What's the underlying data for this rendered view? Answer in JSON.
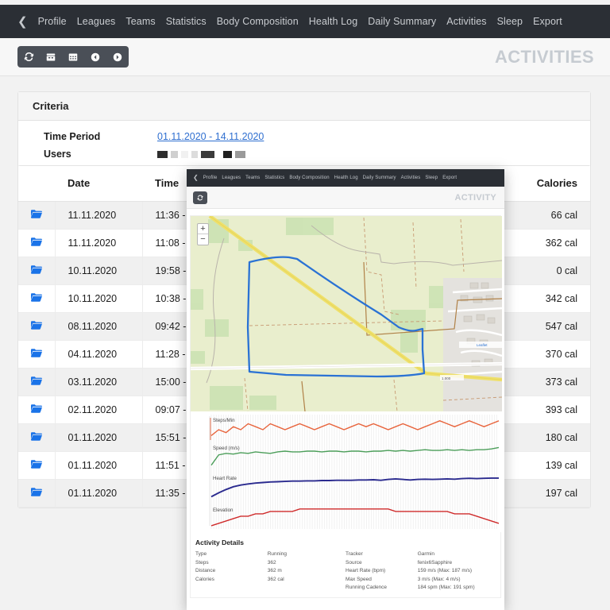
{
  "nav": {
    "back_icon": "chevron-left-icon",
    "items": [
      "Profile",
      "Leagues",
      "Teams",
      "Statistics",
      "Body Composition",
      "Health Log",
      "Daily Summary",
      "Activities",
      "Sleep",
      "Export"
    ]
  },
  "toolbar": {
    "buttons": [
      {
        "name": "refresh-button",
        "icon": "refresh-icon"
      },
      {
        "name": "date-picker-button",
        "icon": "calendar-icon"
      },
      {
        "name": "month-picker-button",
        "icon": "calendar-grid-icon"
      },
      {
        "name": "previous-button",
        "icon": "chevron-left-circle-icon"
      },
      {
        "name": "next-button",
        "icon": "chevron-right-circle-icon"
      }
    ],
    "page_title": "ACTIVITIES"
  },
  "criteria": {
    "heading": "Criteria",
    "time_period_label": "Time Period",
    "time_period_value": "01.11.2020 - 14.11.2020",
    "users_label": "Users",
    "users_value_redacted": true
  },
  "table": {
    "columns": [
      "",
      "Date",
      "Time",
      "Calories"
    ],
    "rows": [
      {
        "icon": "folder-icon",
        "date": "11.11.2020",
        "time": "11:36 - 11",
        "calories": "66 cal"
      },
      {
        "icon": "folder-icon",
        "date": "11.11.2020",
        "time": "11:08 - 11",
        "calories": "362 cal"
      },
      {
        "icon": "folder-icon",
        "date": "10.11.2020",
        "time": "19:58 - 1",
        "calories": "0 cal"
      },
      {
        "icon": "folder-icon",
        "date": "10.11.2020",
        "time": "10:38 - 1",
        "calories": "342 cal"
      },
      {
        "icon": "folder-icon",
        "date": "08.11.2020",
        "time": "09:42 - 1",
        "calories": "547 cal"
      },
      {
        "icon": "folder-icon",
        "date": "04.11.2020",
        "time": "11:28 - 11",
        "calories": "370 cal"
      },
      {
        "icon": "folder-icon",
        "date": "03.11.2020",
        "time": "15:00 - 1",
        "calories": "373 cal"
      },
      {
        "icon": "folder-icon",
        "date": "02.11.2020",
        "time": "09:07 - 0",
        "calories": "393 cal"
      },
      {
        "icon": "folder-icon",
        "date": "01.11.2020",
        "time": "15:51 - 16",
        "calories": "180 cal"
      },
      {
        "icon": "folder-icon",
        "date": "01.11.2020",
        "time": "11:51 - 12",
        "calories": "139 cal"
      },
      {
        "icon": "folder-icon",
        "date": "01.11.2020",
        "time": "11:35 - 11",
        "calories": "197 cal"
      }
    ]
  },
  "popup": {
    "nav_items": [
      "Profile",
      "Leagues",
      "Teams",
      "Statistics",
      "Body Composition",
      "Health Log",
      "Daily Summary",
      "Activities",
      "Sleep",
      "Export"
    ],
    "refresh_icon": "refresh-icon",
    "title": "ACTIVITY",
    "map": {
      "zoom_in": "+",
      "zoom_out": "−",
      "attribution": "Leaflet",
      "track_color": "#2a72d4"
    },
    "charts": {
      "series": [
        {
          "label": "Steps/Min",
          "color": "#e8643c"
        },
        {
          "label": "Speed (m/s)",
          "color": "#4c9e5a"
        },
        {
          "label": "Heart Rate",
          "color": "#2b2b8f"
        },
        {
          "label": "Elevation",
          "color": "#cf2b2b"
        }
      ]
    },
    "details": {
      "title": "Activity Details",
      "left": [
        {
          "key": "Type",
          "value": "Running"
        },
        {
          "key": "Steps",
          "value": "362"
        },
        {
          "key": "Distance",
          "value": "362 m"
        },
        {
          "key": "Calories",
          "value": "362 cal"
        }
      ],
      "right": [
        {
          "key": "Tracker",
          "value": "Garmin"
        },
        {
          "key": "Source",
          "value": "fenix6Sapphire"
        },
        {
          "key": "Heart Rate (bpm)",
          "value": "159 m/s (Max: 187 m/s)"
        },
        {
          "key": "Max Speed",
          "value": "3 m/s (Max: 4 m/s)"
        },
        {
          "key": "Running Cadence",
          "value": "184 spm (Max: 191 spm)"
        }
      ]
    }
  },
  "chart_data": {
    "type": "line",
    "title": "Activity time series",
    "xlabel": "",
    "ylabel": "",
    "grid": true,
    "legend_position": "inline-left",
    "series": [
      {
        "name": "Steps/Min",
        "color": "#e8643c",
        "values": [
          180,
          182,
          181,
          183,
          182,
          184,
          183,
          182,
          184,
          183,
          182,
          183,
          184,
          183,
          182,
          183,
          184,
          183,
          182,
          183,
          184,
          183,
          184,
          183,
          182,
          183,
          184,
          183,
          182,
          183,
          184,
          185,
          184,
          183,
          184,
          185,
          184,
          183,
          184,
          185
        ]
      },
      {
        "name": "Speed (m/s)",
        "color": "#4c9e5a",
        "values": [
          1.2,
          2.6,
          2.8,
          2.7,
          2.9,
          2.8,
          3.0,
          2.9,
          2.8,
          3.0,
          3.1,
          3.0,
          3.0,
          3.1,
          3.1,
          3.0,
          3.1,
          3.1,
          3.0,
          3.1,
          3.1,
          3.0,
          3.1,
          3.1,
          3.2,
          3.1,
          3.2,
          3.1,
          3.2,
          3.3,
          3.2,
          3.2,
          3.3,
          3.2,
          3.3,
          3.2,
          3.3,
          3.3,
          3.4,
          3.6
        ]
      },
      {
        "name": "Heart Rate",
        "color": "#2b2b8f",
        "values": [
          104,
          118,
          130,
          140,
          146,
          150,
          153,
          155,
          157,
          158,
          159,
          160,
          160,
          161,
          161,
          162,
          162,
          163,
          163,
          163,
          164,
          164,
          165,
          163,
          166,
          168,
          166,
          164,
          166,
          167,
          166,
          167,
          168,
          167,
          169,
          170,
          169,
          170,
          171,
          171
        ]
      },
      {
        "name": "Elevation",
        "color": "#cf2b2b",
        "values": [
          60,
          61,
          62,
          63,
          64,
          64,
          65,
          65,
          66,
          66,
          66,
          66,
          67,
          67,
          67,
          67,
          67,
          67,
          67,
          67,
          67,
          67,
          67,
          67,
          67,
          66,
          66,
          66,
          66,
          66,
          66,
          66,
          66,
          65,
          65,
          65,
          64,
          63,
          62,
          61
        ]
      }
    ],
    "xlim": [
      0,
      39
    ],
    "ylim": [
      0,
      200
    ]
  }
}
